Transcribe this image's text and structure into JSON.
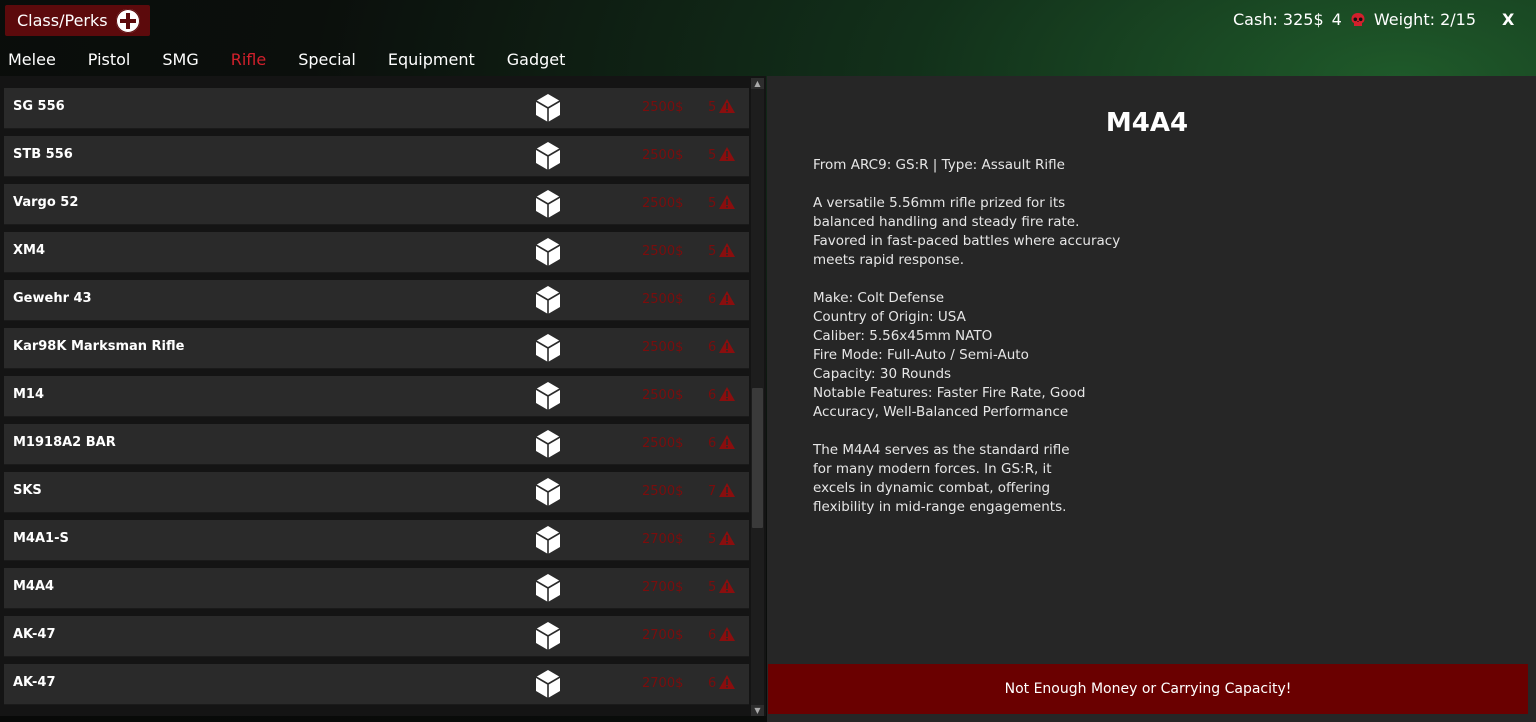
{
  "header": {
    "class_perks_label": "Class/Perks",
    "cash": "Cash: 325$",
    "kills": "4",
    "weight": "Weight: 2/15",
    "close_label": "X"
  },
  "tabs": [
    "Melee",
    "Pistol",
    "SMG",
    "Rifle",
    "Special",
    "Equipment",
    "Gadget"
  ],
  "active_tab": "Rifle",
  "items": [
    {
      "name": "SG 556",
      "price": "2500$",
      "weight": "5"
    },
    {
      "name": "STB 556",
      "price": "2500$",
      "weight": "5"
    },
    {
      "name": "Vargo 52",
      "price": "2500$",
      "weight": "5"
    },
    {
      "name": "XM4",
      "price": "2500$",
      "weight": "5"
    },
    {
      "name": "Gewehr 43",
      "price": "2500$",
      "weight": "6"
    },
    {
      "name": "Kar98K Marksman Rifle",
      "price": "2500$",
      "weight": "6"
    },
    {
      "name": "M14",
      "price": "2500$",
      "weight": "6"
    },
    {
      "name": "M1918A2 BAR",
      "price": "2500$",
      "weight": "6"
    },
    {
      "name": "SKS",
      "price": "2500$",
      "weight": "7"
    },
    {
      "name": "M4A1-S",
      "price": "2700$",
      "weight": "5"
    },
    {
      "name": "M4A4",
      "price": "2700$",
      "weight": "5"
    },
    {
      "name": "AK-47",
      "price": "2700$",
      "weight": "6"
    },
    {
      "name": "AK-47",
      "price": "2700$",
      "weight": "6"
    }
  ],
  "detail": {
    "title": "M4A4",
    "source": "From ARC9: GS:R | Type: Assault Rifle",
    "description": [
      "A versatile 5.56mm rifle prized for its",
      "balanced handling and steady fire rate.",
      "Favored in fast-paced battles where accuracy",
      "meets rapid response."
    ],
    "specs": [
      "Make: Colt Defense",
      "Country of Origin: USA",
      "Caliber: 5.56x45mm NATO",
      "Fire Mode: Full-Auto / Semi-Auto",
      "Capacity: 30 Rounds",
      "Notable Features: Faster Fire Rate, Good",
      "Accuracy, Well-Balanced Performance"
    ],
    "summary": [
      "The M4A4 serves as the standard rifle",
      "for many modern forces. In GS:R, it",
      "excels in dynamic combat, offering",
      "flexibility in mid-range engagements."
    ],
    "buy_label": "Not Enough Money or Carrying Capacity!"
  },
  "colors": {
    "accent": "#d2202c",
    "price_text": "#7a0d0d",
    "button_bg": "#6a0000"
  }
}
